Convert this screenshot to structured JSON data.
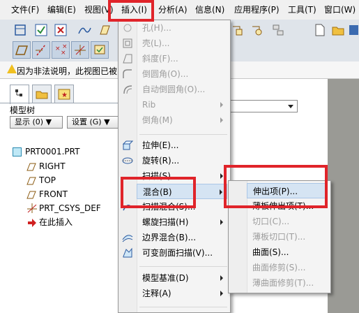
{
  "menubar": {
    "items": [
      {
        "label": "文件(F)"
      },
      {
        "label": "编辑(E)"
      },
      {
        "label": "视图(V)"
      },
      {
        "label": "插入(I)"
      },
      {
        "label": "分析(A)"
      },
      {
        "label": "信息(N)"
      },
      {
        "label": "应用程序(P)"
      },
      {
        "label": "工具(T)"
      },
      {
        "label": "窗口(W)"
      }
    ]
  },
  "warning": {
    "text": "因为非法说明，此视图已被"
  },
  "left_panel": {
    "tree_title": "模型树",
    "show_label": "显示 (0) ▼",
    "settings_label": "设置 (G) ▼",
    "tree": [
      {
        "label": "PRT0001.PRT",
        "icon": "part-icon"
      },
      {
        "label": "RIGHT",
        "icon": "datum-plane-icon"
      },
      {
        "label": "TOP",
        "icon": "datum-plane-icon"
      },
      {
        "label": "FRONT",
        "icon": "datum-plane-icon"
      },
      {
        "label": "PRT_CSYS_DEF",
        "icon": "csys-icon"
      },
      {
        "label": "在此插入",
        "icon": "insert-here-arrow-icon"
      }
    ]
  },
  "insert_menu": {
    "items": [
      {
        "label": "孔(H)...",
        "disabled": true
      },
      {
        "label": "壳(L)...",
        "disabled": true
      },
      {
        "label": "斜度(F)...",
        "disabled": true
      },
      {
        "label": "倒圆角(O)...",
        "disabled": true
      },
      {
        "label": "自动倒圆角(O)...",
        "disabled": true
      },
      {
        "label": "Rib",
        "disabled": true
      },
      {
        "label": "倒角(M)",
        "disabled": true
      },
      {
        "label": "拉伸(E)..."
      },
      {
        "label": "旋转(R)..."
      },
      {
        "label": "扫描(S)"
      },
      {
        "label": "混合(B)"
      },
      {
        "label": "扫描混合(S)..."
      },
      {
        "label": "螺旋扫描(H)"
      },
      {
        "label": "边界混合(B)..."
      },
      {
        "label": "可变剖面扫描(V)..."
      },
      {
        "label": "模型基准(D)"
      },
      {
        "label": "注释(A)"
      }
    ]
  },
  "blend_submenu": {
    "items": [
      {
        "label": "伸出项(P)..."
      },
      {
        "label": "薄板伸出项(T)..."
      },
      {
        "label": "切口(C)...",
        "disabled": true
      },
      {
        "label": "薄板切口(T)...",
        "disabled": true
      },
      {
        "label": "曲面(S)..."
      },
      {
        "label": "曲面修剪(S)...",
        "disabled": true
      },
      {
        "label": "薄曲面修剪(T)...",
        "disabled": true
      }
    ]
  },
  "colors": {
    "highlight_box": "#e0242a",
    "hover": "#d5e4f3"
  }
}
